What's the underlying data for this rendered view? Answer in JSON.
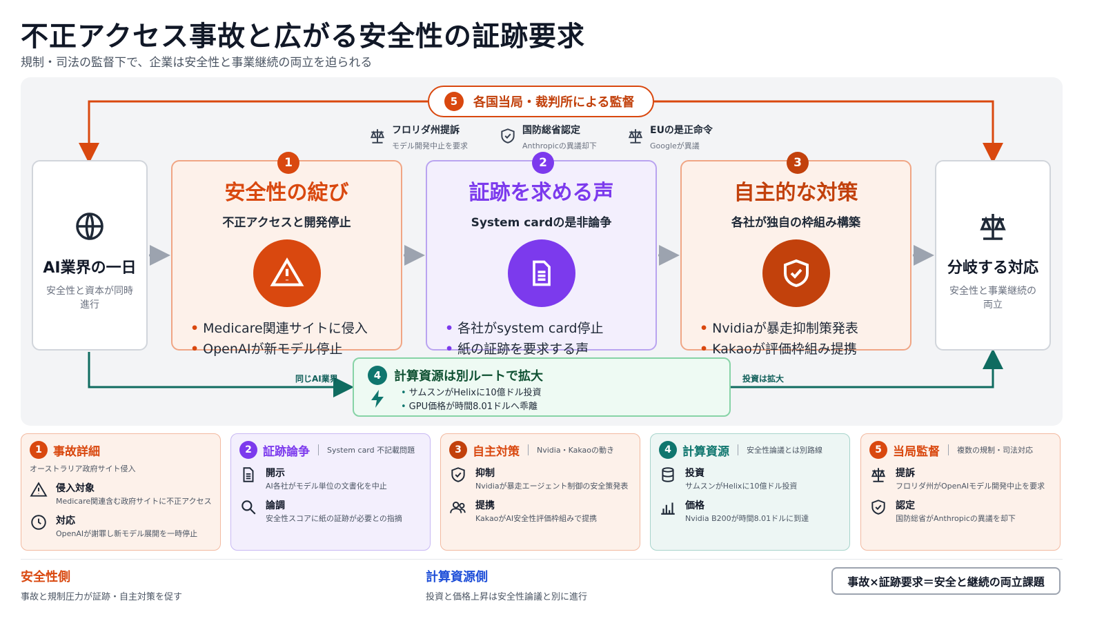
{
  "header": {
    "title": "不正アクセス事故と広がる安全性の証跡要求",
    "subtitle": "規制・司法の監督下で、企業は安全性と事業継続の両立を迫られる"
  },
  "oversight": {
    "number": "5",
    "label": "各国当局・裁判所による監督",
    "items": [
      {
        "title": "フロリダ州提訴",
        "desc": "モデル開発中止を要求",
        "icon": "scale-icon"
      },
      {
        "title": "国防総省認定",
        "desc": "Anthropicの異議却下",
        "icon": "shield-icon"
      },
      {
        "title": "EUの是正命令",
        "desc": "Googleが異議",
        "icon": "scale-icon"
      }
    ]
  },
  "start_box": {
    "title": "AI業界の一日",
    "desc": "安全性と資本が同時進行",
    "icon": "globe-icon"
  },
  "end_box": {
    "title": "分岐する対応",
    "desc": "安全性と事業継続の両立",
    "icon": "scale-icon"
  },
  "stages": [
    {
      "number": "1",
      "title": "安全性の綻び",
      "subtitle": "不正アクセスと開発停止",
      "icon": "warning-icon",
      "bullets": [
        "Medicare関連サイトに侵入",
        "OpenAIが新モデル停止"
      ]
    },
    {
      "number": "2",
      "title": "証跡を求める声",
      "subtitle": "System cardの是非論争",
      "icon": "document-icon",
      "bullets": [
        "各社がsystem card停止",
        "紙の証跡を要求する声"
      ]
    },
    {
      "number": "3",
      "title": "自主的な対策",
      "subtitle": "各社が独自の枠組み構築",
      "icon": "shield-check-icon",
      "bullets": [
        "Nvidiaが暴走抑制策発表",
        "Kakaoが評価枠組み提携"
      ]
    }
  ],
  "bullet_mark": "•",
  "compute": {
    "number": "4",
    "title": "計算資源は別ルートで拡大",
    "bullets": [
      "サムスンがHelixに10億ドル投資",
      "GPU価格が時間8.01ドルへ乖離"
    ],
    "label_left": "同じAI業界",
    "label_right": "投資は拡大"
  },
  "cards": [
    {
      "number": "1",
      "title": "事故詳細",
      "note": "",
      "sub": "オーストラリア政府サイト侵入",
      "items": [
        {
          "icon": "warning-icon",
          "title": "侵入対象",
          "desc": "Medicare関連含む政府サイトに不正アクセス"
        },
        {
          "icon": "clock-icon",
          "title": "対応",
          "desc": "OpenAIが謝罪し新モデル展開を一時停止"
        }
      ]
    },
    {
      "number": "2",
      "title": "証跡論争",
      "note": "System card 不記載問題",
      "sub": "",
      "items": [
        {
          "icon": "document-icon",
          "title": "開示",
          "desc": "AI各社がモデル単位の文書化を中止"
        },
        {
          "icon": "search-icon",
          "title": "論調",
          "desc": "安全性スコアに紙の証跡が必要との指摘"
        }
      ]
    },
    {
      "number": "3",
      "title": "自主対策",
      "note": "Nvidia・Kakaoの動き",
      "sub": "",
      "items": [
        {
          "icon": "shield-check-icon",
          "title": "抑制",
          "desc": "Nvidiaが暴走エージェント制御の安全策発表"
        },
        {
          "icon": "users-icon",
          "title": "提携",
          "desc": "KakaoがAI安全性評価枠組みで提携"
        }
      ]
    },
    {
      "number": "4",
      "title": "計算資源",
      "note": "安全性論議とは別路線",
      "sub": "",
      "items": [
        {
          "icon": "database-icon",
          "title": "投資",
          "desc": "サムスンがHelixに10億ドル投資"
        },
        {
          "icon": "bar-chart-icon",
          "title": "価格",
          "desc": "Nvidia B200が時間8.01ドルに到達"
        }
      ]
    },
    {
      "number": "5",
      "title": "当局監督",
      "note": "複数の規制・司法対応",
      "sub": "",
      "items": [
        {
          "icon": "scale-icon",
          "title": "提訴",
          "desc": "フロリダ州がOpenAIモデル開発中止を要求"
        },
        {
          "icon": "shield-check-icon",
          "title": "認定",
          "desc": "国防総省がAnthropicの異議を却下"
        }
      ]
    }
  ],
  "footer": {
    "left": {
      "title": "安全性側",
      "desc": "事故と規制圧力が証跡・自主対策を促す"
    },
    "mid": {
      "title": "計算資源側",
      "desc": "投資と価格上昇は安全性論議と別に進行"
    },
    "formula": "事故×証跡要求＝安全と継続の両立課題"
  },
  "colors": {
    "orange": "#d9480f",
    "purple": "#7c3aed",
    "green": "#0f766e",
    "blue": "#1d4ed8"
  }
}
